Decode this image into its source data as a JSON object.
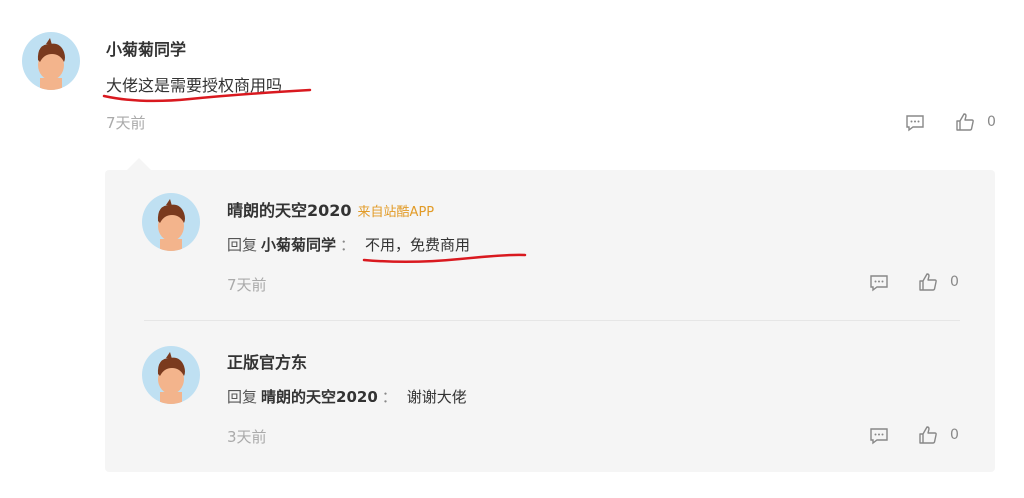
{
  "main_comment": {
    "username": "小菊菊同学",
    "text": "大佬这是需要授权商用吗",
    "time": "7天前",
    "like_count": "0",
    "reply_icon": "comment-icon",
    "like_icon": "thumbs-up-icon"
  },
  "replies": [
    {
      "username": "晴朗的天空2020",
      "source": "来自站酷APP",
      "reply_prefix": "回复",
      "reply_target": "小菊菊同学",
      "colon": "：",
      "text": "不用，免费商用",
      "time": "7天前",
      "like_count": "0"
    },
    {
      "username": "正版官方东",
      "reply_prefix": "回复",
      "reply_target": "晴朗的天空2020",
      "colon": "：",
      "text": "谢谢大佬",
      "time": "3天前",
      "like_count": "0"
    }
  ],
  "colors": {
    "avatar_bg": "#bfe0f2",
    "source_color": "#e29b27",
    "annotation_red": "#d9191f",
    "reply_box_bg": "#f5f5f5"
  }
}
